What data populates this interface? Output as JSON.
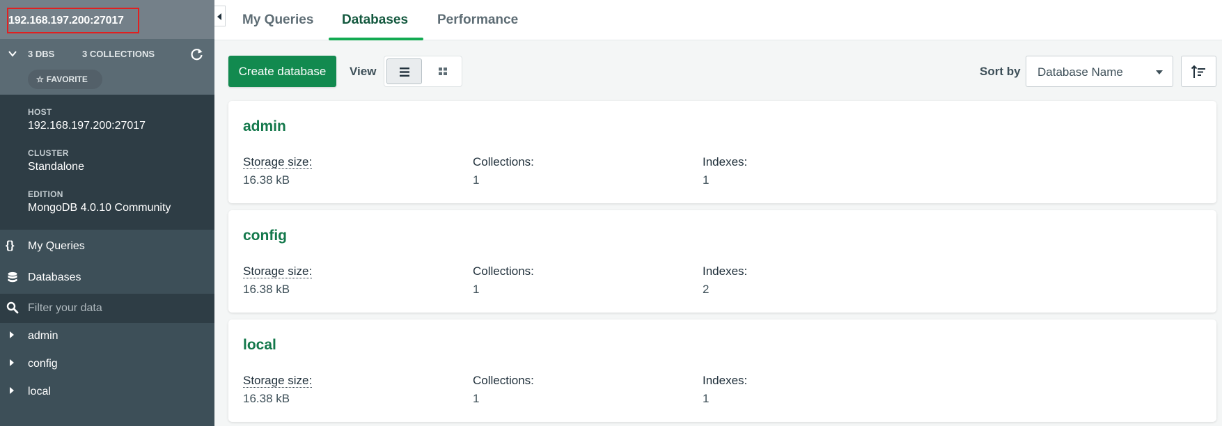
{
  "sidebar": {
    "connection_title": "192.168.197.200:27017",
    "stats": {
      "dbs": "3 DBS",
      "collections": "3 COLLECTIONS"
    },
    "favorite_label": "FAVORITE",
    "info": {
      "host_label": "HOST",
      "host_value": "192.168.197.200:27017",
      "cluster_label": "CLUSTER",
      "cluster_value": "Standalone",
      "edition_label": "EDITION",
      "edition_value": "MongoDB 4.0.10 Community"
    },
    "nav": {
      "queries_icon": "{}",
      "queries": "My Queries",
      "databases": "Databases"
    },
    "filter_placeholder": "Filter your data",
    "tree": [
      "admin",
      "config",
      "local"
    ]
  },
  "tabs": {
    "queries": "My Queries",
    "databases": "Databases",
    "performance": "Performance"
  },
  "toolbar": {
    "create_label": "Create database",
    "view_label": "View",
    "sort_label": "Sort by",
    "sort_value": "Database Name"
  },
  "labels": {
    "storage": "Storage size:",
    "collections": "Collections:",
    "indexes": "Indexes:"
  },
  "databases": [
    {
      "name": "admin",
      "storage": "16.38 kB",
      "collections": "1",
      "indexes": "1"
    },
    {
      "name": "config",
      "storage": "16.38 kB",
      "collections": "1",
      "indexes": "2"
    },
    {
      "name": "local",
      "storage": "16.38 kB",
      "collections": "1",
      "indexes": "1"
    }
  ],
  "colors": {
    "brand_green": "#13aa52",
    "button_green": "#128a4f",
    "db_name_green": "#13784b",
    "sidebar_bg": "#3d4f58"
  },
  "icons": [
    "chevron-down-icon",
    "refresh-icon",
    "star-icon",
    "braces-icon",
    "database-icon",
    "search-icon",
    "caret-right-icon",
    "list-view-icon",
    "grid-view-icon",
    "sort-direction-icon"
  ]
}
